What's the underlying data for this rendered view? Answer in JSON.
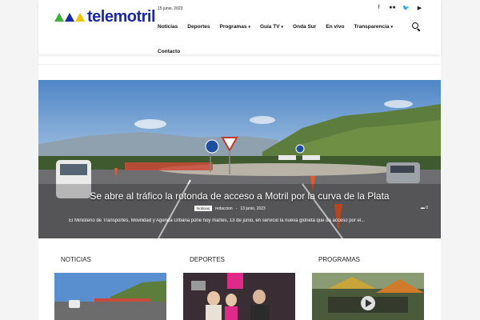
{
  "header": {
    "logo_text": "telemotril",
    "date": "15 junio, 2023",
    "social_icons": [
      "facebook-icon",
      "flickr-icon",
      "twitter-icon",
      "youtube-icon"
    ],
    "nav": [
      {
        "label": "Noticias",
        "dropdown": false
      },
      {
        "label": "Deportes",
        "dropdown": false
      },
      {
        "label": "Programas",
        "dropdown": true
      },
      {
        "label": "Guía TV",
        "dropdown": true
      },
      {
        "label": "Onda Sur",
        "dropdown": false
      },
      {
        "label": "En vivo",
        "dropdown": false
      },
      {
        "label": "Transparencia",
        "dropdown": true
      }
    ],
    "nav_second_row": {
      "label": "Contacto"
    }
  },
  "hero": {
    "title": "Se abre al tráfico la rotonda de acceso a Motril por la curva de la Plata",
    "category": "Noticias",
    "author": "redaccion",
    "separator": "-",
    "date": "13 junio, 2023",
    "comments": "0",
    "excerpt": "El Ministerio de Transportes, Movilidad y Agenda Urbana pone hoy martes, 13 de junio, en servicio la nueva glorieta que da acceso por el..."
  },
  "columns": [
    {
      "title": "NOTICIAS"
    },
    {
      "title": "DEPORTES"
    },
    {
      "title": "PROGRAMAS"
    }
  ],
  "colors": {
    "logo_blue": "#1a2aa6",
    "logo_green": "#3fae3a",
    "logo_yellow": "#f2c300"
  }
}
